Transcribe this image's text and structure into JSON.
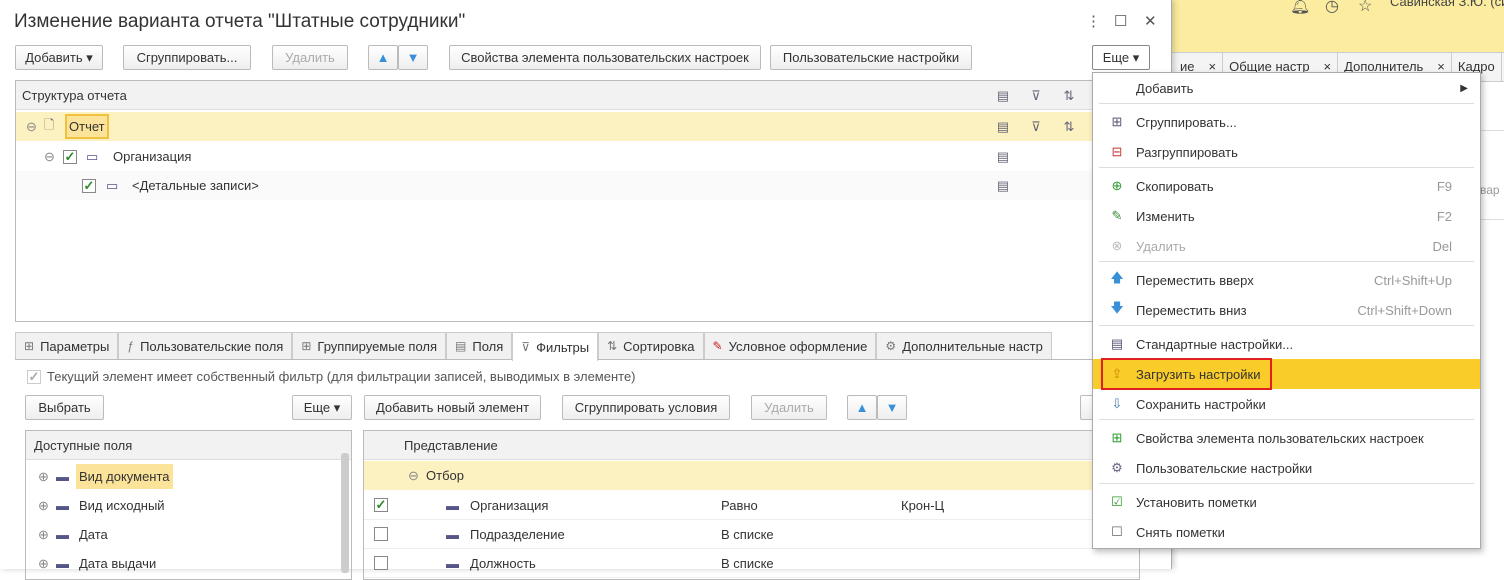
{
  "background": {
    "user": "Савинская З.Ю. (сист",
    "tabs": [
      "ие",
      "Общие настр",
      "Дополнитель",
      "Кадро"
    ],
    "side_text": "вар"
  },
  "dialog": {
    "title": "Изменение варианта отчета \"Штатные сотрудники\"",
    "toolbar": {
      "add": "Добавить",
      "group": "Сгруппировать...",
      "delete": "Удалить",
      "element_props": "Свойства элемента пользовательских настроек",
      "user_settings": "Пользовательские настройки",
      "more": "Еще"
    },
    "structure": {
      "header": "Структура отчета",
      "rows": [
        {
          "label": "Отчет"
        },
        {
          "label": "Организация"
        },
        {
          "label": "<Детальные записи>"
        }
      ]
    },
    "tabs": [
      "Параметры",
      "Пользовательские поля",
      "Группируемые поля",
      "Поля",
      "Фильтры",
      "Сортировка",
      "Условное оформление",
      "Дополнительные настр"
    ],
    "own_filter": "Текущий элемент имеет собственный фильтр (для фильтрации записей, выводимых в элементе)",
    "filter_toolbar": {
      "select": "Выбрать",
      "more": "Еще",
      "add_new": "Добавить новый элемент",
      "group_conditions": "Сгруппировать условия",
      "delete": "Удалить"
    },
    "available_fields": {
      "header": "Доступные поля",
      "items": [
        "Вид документа",
        "Вид исходный",
        "Дата",
        "Дата выдачи"
      ]
    },
    "filters": {
      "header": "Представление",
      "group": "Отбор",
      "rows": [
        {
          "field": "Организация",
          "condition": "Равно",
          "value": "Крон-Ц",
          "checked": true
        },
        {
          "field": "Подразделение",
          "condition": "В списке",
          "value": "",
          "checked": false
        },
        {
          "field": "Должность",
          "condition": "В списке",
          "value": "",
          "checked": false
        }
      ]
    }
  },
  "menu": {
    "items": [
      {
        "label": "Добавить",
        "shortcut": "",
        "icon": "none"
      },
      {
        "label": "Сгруппировать...",
        "shortcut": "",
        "icon": "group-icon"
      },
      {
        "label": "Разгруппировать",
        "shortcut": "",
        "icon": "ungroup-icon"
      },
      {
        "label": "Скопировать",
        "shortcut": "F9",
        "icon": "copy-icon"
      },
      {
        "label": "Изменить",
        "shortcut": "F2",
        "icon": "pencil-icon"
      },
      {
        "label": "Удалить",
        "shortcut": "Del",
        "icon": "delete-icon"
      },
      {
        "label": "Переместить вверх",
        "shortcut": "Ctrl+Shift+Up",
        "icon": "arrow-up-icon"
      },
      {
        "label": "Переместить вниз",
        "shortcut": "Ctrl+Shift+Down",
        "icon": "arrow-down-icon"
      },
      {
        "label": "Стандартные настройки...",
        "shortcut": "",
        "icon": "standard-settings-icon"
      },
      {
        "label": "Загрузить настройки",
        "shortcut": "",
        "icon": "load-settings-icon"
      },
      {
        "label": "Сохранить настройки",
        "shortcut": "",
        "icon": "save-settings-icon"
      },
      {
        "label": "Свойства элемента пользовательских настроек",
        "shortcut": "",
        "icon": "properties-icon"
      },
      {
        "label": "Пользовательские настройки",
        "shortcut": "",
        "icon": "user-settings-icon"
      },
      {
        "label": "Установить пометки",
        "shortcut": "",
        "icon": "check-all-icon"
      },
      {
        "label": "Снять пометки",
        "shortcut": "",
        "icon": "uncheck-all-icon"
      }
    ]
  }
}
